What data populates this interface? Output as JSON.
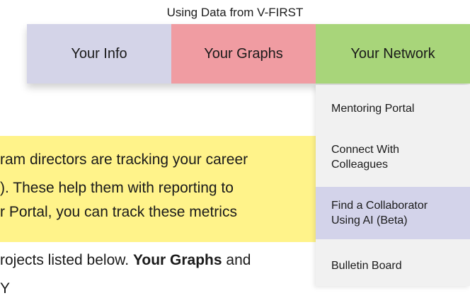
{
  "header": {
    "title": "Using Data from V-FIRST"
  },
  "nav": {
    "tabs": [
      {
        "label": "Your Info",
        "color": "#d4d4e8"
      },
      {
        "label": "Your Graphs",
        "color": "#f09ca2"
      },
      {
        "label": "Your Network",
        "color": "#a8d57a"
      }
    ]
  },
  "dropdown": {
    "items": [
      {
        "label": "Mentoring Portal"
      },
      {
        "label": "Connect With Colleagues"
      },
      {
        "label": "Find a Collaborator Using AI (Beta)",
        "highlighted": true
      },
      {
        "label": "Bulletin Board"
      }
    ]
  },
  "content": {
    "highlight_color": "#fff38a",
    "line_1": "ram directors are tracking your career",
    "line_2": "). These help them with reporting to",
    "line_3": "r Portal, you can track these metrics",
    "line_4_before": "rojects listed below. ",
    "line_4_bold": "Your Graphs",
    "line_4_after": " and",
    "line_5": "  Y"
  }
}
